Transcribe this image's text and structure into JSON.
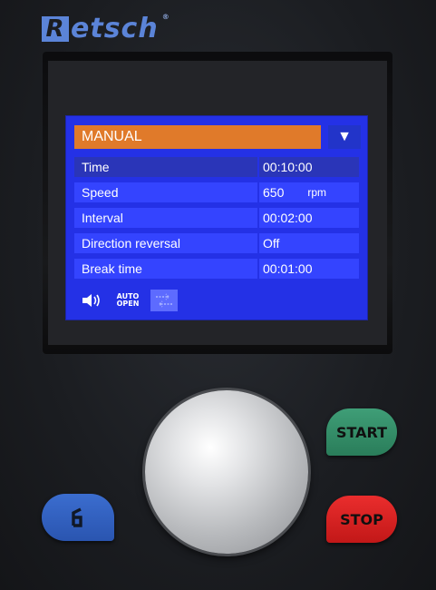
{
  "brand": {
    "name": "etsch",
    "letter": "R",
    "mark": "®"
  },
  "screen": {
    "mode": "MANUAL",
    "dropdown_icon": "▼",
    "rows": [
      {
        "label": "Time",
        "value": "00:10:00",
        "unit": ""
      },
      {
        "label": "Speed",
        "value": "650",
        "unit": "rpm"
      },
      {
        "label": "Interval",
        "value": "00:02:00",
        "unit": ""
      },
      {
        "label": "Direction reversal",
        "value": "Off",
        "unit": ""
      },
      {
        "label": "Break time",
        "value": "00:01:00",
        "unit": ""
      }
    ],
    "icons": {
      "sound": "speaker-icon",
      "auto_line1": "AUTO",
      "auto_line2": "OPEN",
      "reverse": "direction-reversal-icon"
    }
  },
  "buttons": {
    "start": "START",
    "stop": "STOP",
    "door_icon": "door-open-icon"
  },
  "colors": {
    "screen_bg": "#2431e6",
    "header": "#e07a2a",
    "start": "#2f8a64",
    "stop": "#d62020",
    "door": "#2f5fc0"
  }
}
